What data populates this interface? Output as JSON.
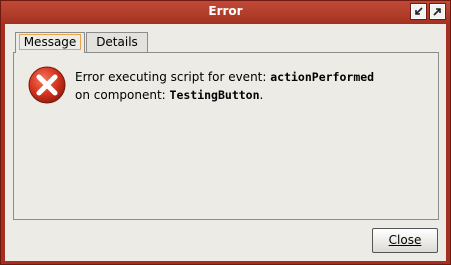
{
  "window": {
    "title": "Error"
  },
  "tabs": [
    {
      "label": "Message",
      "active": true
    },
    {
      "label": "Details",
      "active": false
    }
  ],
  "message": {
    "line1_prefix": "Error executing script for event: ",
    "event_name": "actionPerformed",
    "line2_prefix": "on component: ",
    "component_name": "TestingButton",
    "line2_suffix": "."
  },
  "buttons": {
    "close_label": "Close"
  },
  "icons": {
    "title_minimize": "restore-down-icon",
    "title_maximize": "maximize-icon",
    "error": "error-x-icon"
  },
  "colors": {
    "frame": "#a62f1f",
    "client_bg": "#ecebe6",
    "error_red": "#d9341f",
    "tab_focus": "#e6a64a"
  }
}
